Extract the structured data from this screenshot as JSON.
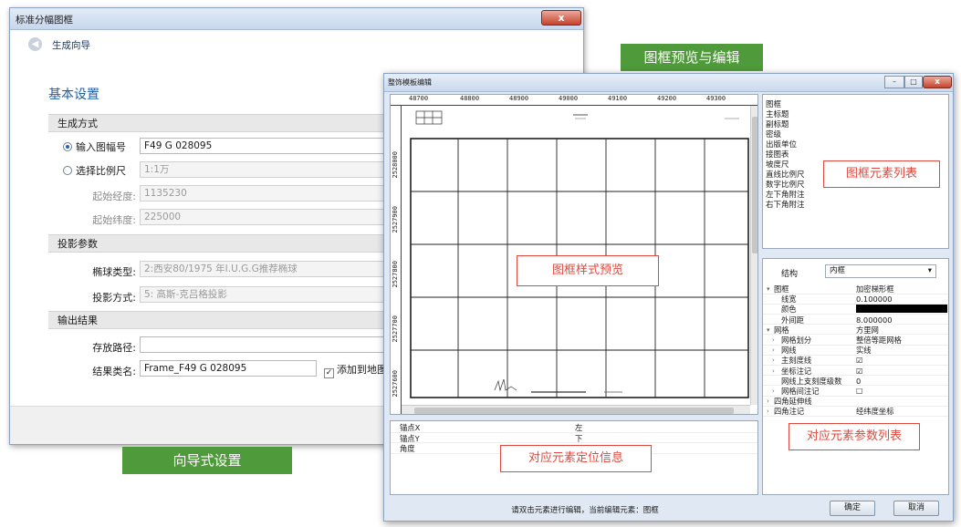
{
  "wizard": {
    "title": "标准分幅图框",
    "close_label": "x",
    "nav_title": "生成向导",
    "section_title": "基本设置",
    "gen_mode": {
      "header": "生成方式",
      "radio_sheet": "输入图幅号",
      "sheet_value": "F49 G 028095",
      "radio_scale": "选择比例尺",
      "scale_value": "1:1万",
      "lon_label": "起始经度:",
      "lon_value": "1135230",
      "lat_label": "起始纬度:",
      "lat_value": "225000"
    },
    "projection": {
      "header": "投影参数",
      "ellipsoid_label": "椭球类型:",
      "ellipsoid_value": "2:西安80/1975 年I.U.G.G推荐椭球",
      "method_label": "投影方式:",
      "method_value": "5: 高斯-克吕格投影"
    },
    "output": {
      "header": "输出结果",
      "path_label": "存放路径:",
      "path_value": "",
      "class_label": "结果类名:",
      "class_value": "Frame_F49 G 028095",
      "add_to_map": "添加到地图"
    }
  },
  "labels": {
    "wizard_caption": "向导式设置",
    "editor_caption": "图框预览与编辑"
  },
  "editor": {
    "title": "整饰模板编辑",
    "ruler_ticks": [
      "48700",
      "48800",
      "48900",
      "49000",
      "49100",
      "49200",
      "49300"
    ],
    "vruler_ticks": [
      "2528000",
      "2527900",
      "2527800",
      "2527700",
      "2527600"
    ],
    "preview_tag": "图框样式预览",
    "element_tag": "图框元素列表",
    "position_tag": "对应元素定位信息",
    "param_tag": "对应元素参数列表",
    "elements": [
      "图框",
      "主标题",
      "副标题",
      "密级",
      "出版单位",
      "接图表",
      "坡度尺",
      "直线比例尺",
      "数字比例尺",
      "左下角附注",
      "右下角附注"
    ],
    "struct_label": "结构",
    "struct_value": "内框",
    "properties": [
      {
        "key": "图框",
        "value": "加密梯形框",
        "level": 0,
        "arrow": "-"
      },
      {
        "key": "线宽",
        "value": "0.100000",
        "level": 1,
        "arrow": ""
      },
      {
        "key": "颜色",
        "value": "",
        "level": 1,
        "arrow": "",
        "color": "#000000"
      },
      {
        "key": "外间距",
        "value": "8.000000",
        "level": 1,
        "arrow": ""
      },
      {
        "key": "网格",
        "value": "方里网",
        "level": 0,
        "arrow": "-"
      },
      {
        "key": "网格划分",
        "value": "整倍等距网格",
        "level": 1,
        "arrow": ">"
      },
      {
        "key": "网线",
        "value": "实线",
        "level": 1,
        "arrow": ">"
      },
      {
        "key": "主刻度线",
        "value": "☑",
        "level": 1,
        "arrow": ">"
      },
      {
        "key": "坐标注记",
        "value": "☑",
        "level": 1,
        "arrow": ">"
      },
      {
        "key": "网线上支刻度级数",
        "value": "0",
        "level": 1,
        "arrow": ""
      },
      {
        "key": "网格间注记",
        "value": "☐",
        "level": 1,
        "arrow": ">"
      },
      {
        "key": "四角延伸线",
        "value": "",
        "level": 0,
        "arrow": ">"
      },
      {
        "key": "四角注记",
        "value": "经纬度坐标",
        "level": 0,
        "arrow": ">"
      }
    ],
    "position_rows": [
      {
        "key": "锚点X",
        "value": "左"
      },
      {
        "key": "锚点Y",
        "value": "下"
      },
      {
        "key": "角度",
        "value": ""
      }
    ],
    "status_text": "请双击元素进行编辑，当前编辑元素：图框",
    "ok_label": "确定",
    "cancel_label": "取消"
  }
}
